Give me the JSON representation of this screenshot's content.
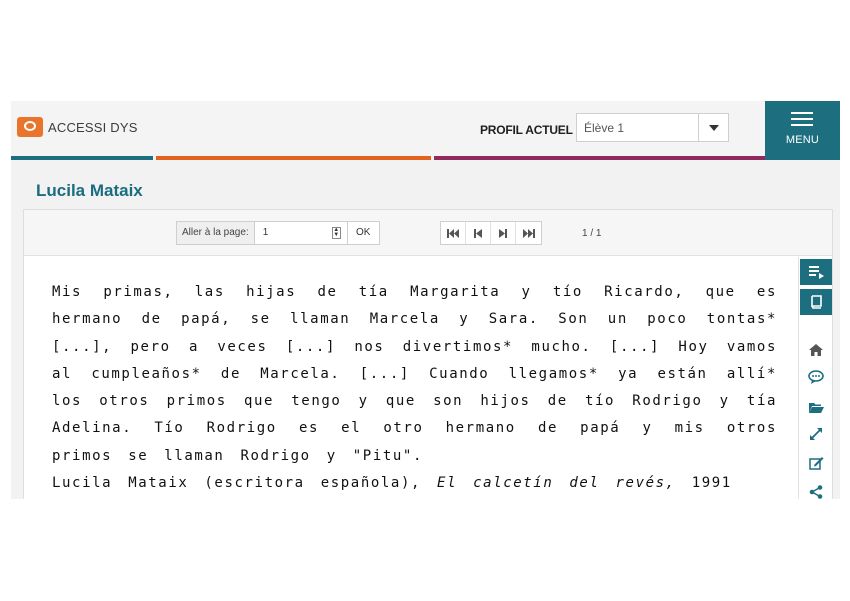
{
  "app": {
    "logo_text": "ACCESSI DYS",
    "profile_label": "PROFIL ACTUEL",
    "profile_value": "Élève 1",
    "menu_label": "MENU"
  },
  "colors": {
    "teal": "#1d6f80",
    "orange": "#e2631f",
    "plum": "#8e2a5e",
    "logo_orange": "#e9742b"
  },
  "page": {
    "title": "Lucila Mataix"
  },
  "toolbar": {
    "goto_label": "Aller à la page:",
    "page_input": "1",
    "ok_label": "OK",
    "page_count": "1 / 1",
    "nav_icons": [
      "first-page-icon",
      "previous-page-icon",
      "next-page-icon",
      "last-page-icon"
    ]
  },
  "passage": {
    "body": "Mis primas, las hijas de tía Margarita y tío Ricardo, que es hermano de papá, se llaman Marcela y Sara. Son un poco tontas* [...], pero a veces [...] nos divertimos* mucho. [...] Hoy vamos al cumpleaños* de Marcela. [...] Cuando llegamos* ya están allí* los otros primos que tengo y que son hijos de tío Rodrigo y tía Adelina. Tío Rodrigo es el otro hermano de papá y mis otros primos se llaman Rodrigo y \"Pitu\".",
    "citation_author": "Lucila Mataix (escritora española),",
    "citation_book": "El calcetín del revés,",
    "citation_year": "1991"
  },
  "sidebar_icons": [
    "reading-list-icon",
    "book-icon",
    "home-icon",
    "comment-icon",
    "folder-open-icon",
    "expand-icon",
    "edit-icon",
    "share-icon"
  ]
}
